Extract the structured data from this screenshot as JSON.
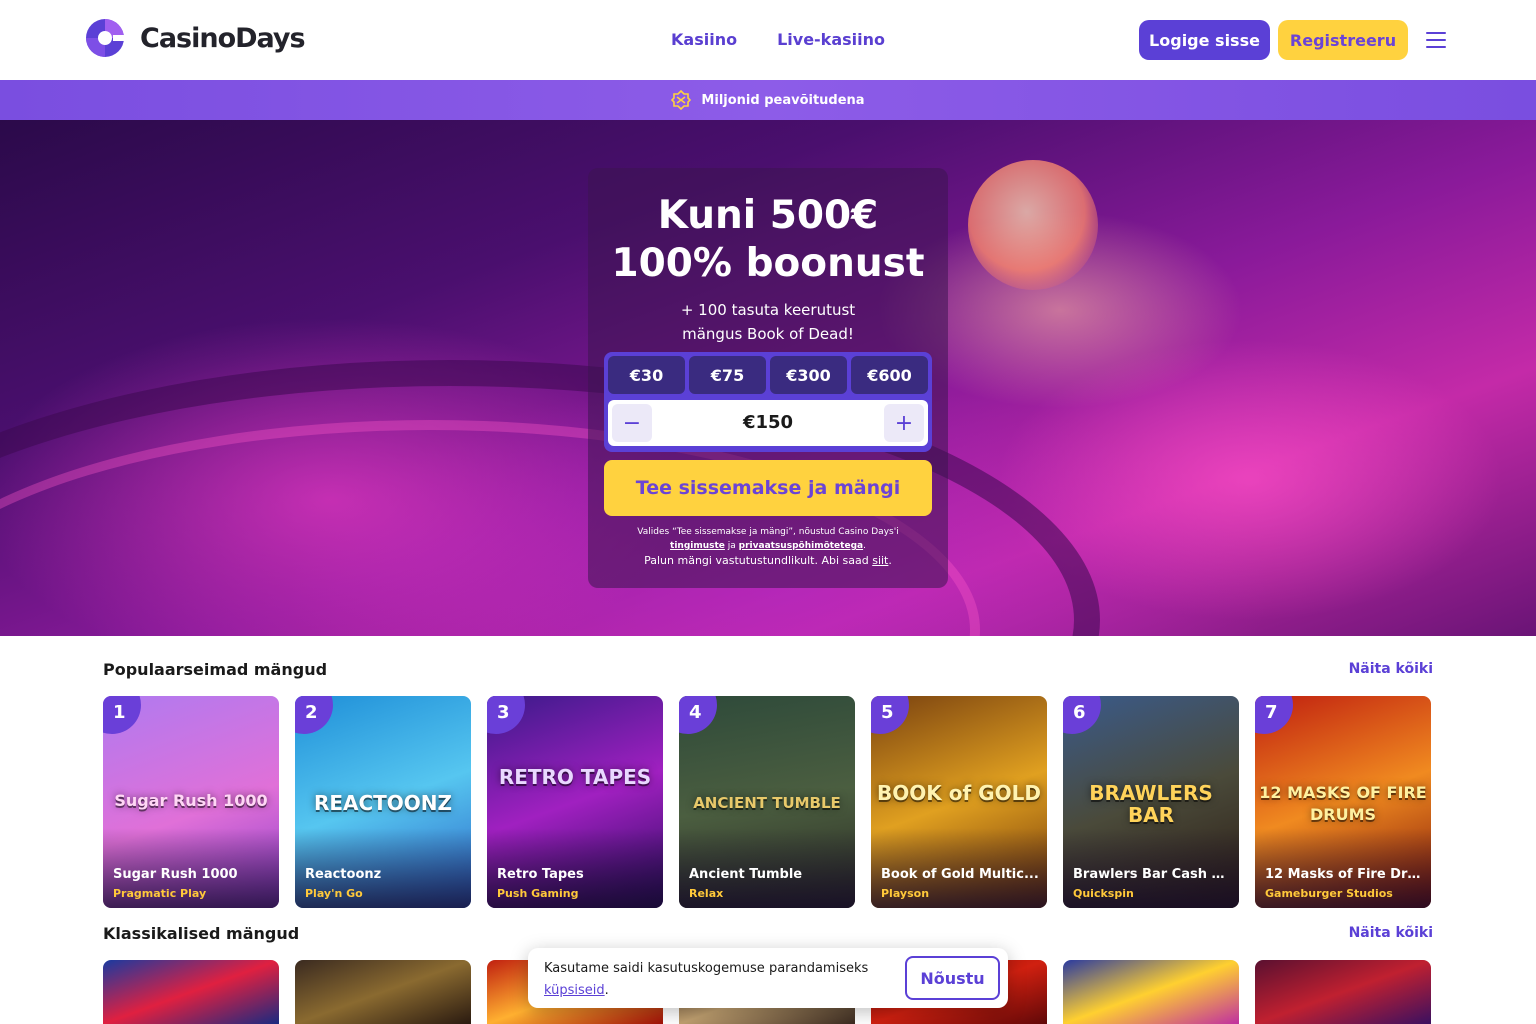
{
  "header": {
    "brand": "CasinoDays",
    "nav": [
      "Kasiino",
      "Live-kasiino"
    ],
    "login_label": "Logige sisse",
    "register_label": "Registreeru"
  },
  "promo_bar": {
    "text": "Miljonid peavõitudena"
  },
  "hero": {
    "title_line1": "Kuni 500€",
    "title_line2": "100% boonust",
    "sub_line1": "+ 100 tasuta keerutust",
    "sub_line2": "mängus Book of Dead!",
    "chips": [
      "€30",
      "€75",
      "€300",
      "€600"
    ],
    "amount": "€150",
    "minus": "−",
    "plus": "+",
    "cta": "Tee sissemakse ja mängi",
    "legal_pre": "Valides “Tee sissemakse ja mängi”, nõustud Casino Days'i",
    "legal_terms": "tingimuste",
    "legal_and": "ja",
    "legal_privacy": "privaatsuspõhimõtetega",
    "legal_end": ".",
    "responsible_pre": "Palun mängi vastutustundlikult. Abi saad",
    "responsible_link": "siit",
    "responsible_end": "."
  },
  "sections": {
    "popular_title": "Populaarseimad mängud",
    "classic_title": "Klassikalised mängud",
    "see_all": "Näita kõiki"
  },
  "popular_games": [
    {
      "rank": "1",
      "name": "Sugar Rush 1000",
      "provider": "Pragmatic Play",
      "art": "Sugar Rush 1000"
    },
    {
      "rank": "2",
      "name": "Reactoonz",
      "provider": "Play'n Go",
      "art": "REACTOONZ"
    },
    {
      "rank": "3",
      "name": "Retro Tapes",
      "provider": "Push Gaming",
      "art": "RETRO TAPES"
    },
    {
      "rank": "4",
      "name": "Ancient Tumble",
      "provider": "Relax",
      "art": "ANCIENT TUMBLE"
    },
    {
      "rank": "5",
      "name": "Book of Gold Multic...",
      "provider": "Playson",
      "art": "BOOK of GOLD"
    },
    {
      "rank": "6",
      "name": "Brawlers Bar Cash C...",
      "provider": "Quickspin",
      "art": "BRAWLERS BAR"
    },
    {
      "rank": "7",
      "name": "12 Masks of Fire Dru...",
      "provider": "Gameburger Studios",
      "art": "12 MASKS OF FIRE DRUMS"
    }
  ],
  "cookie": {
    "text": "Kasutame saidi kasutuskogemuse parandamiseks",
    "link": "küpsiseid",
    "end": ".",
    "accept": "Nõustu"
  },
  "colors": {
    "accent": "#5b40d6",
    "cta": "#ffd23f",
    "promo_bar": "#7a4ee0",
    "provider_text": "#ffc93a"
  },
  "icons": [
    "menu-icon",
    "trophy-icon",
    "logo-icon"
  ]
}
